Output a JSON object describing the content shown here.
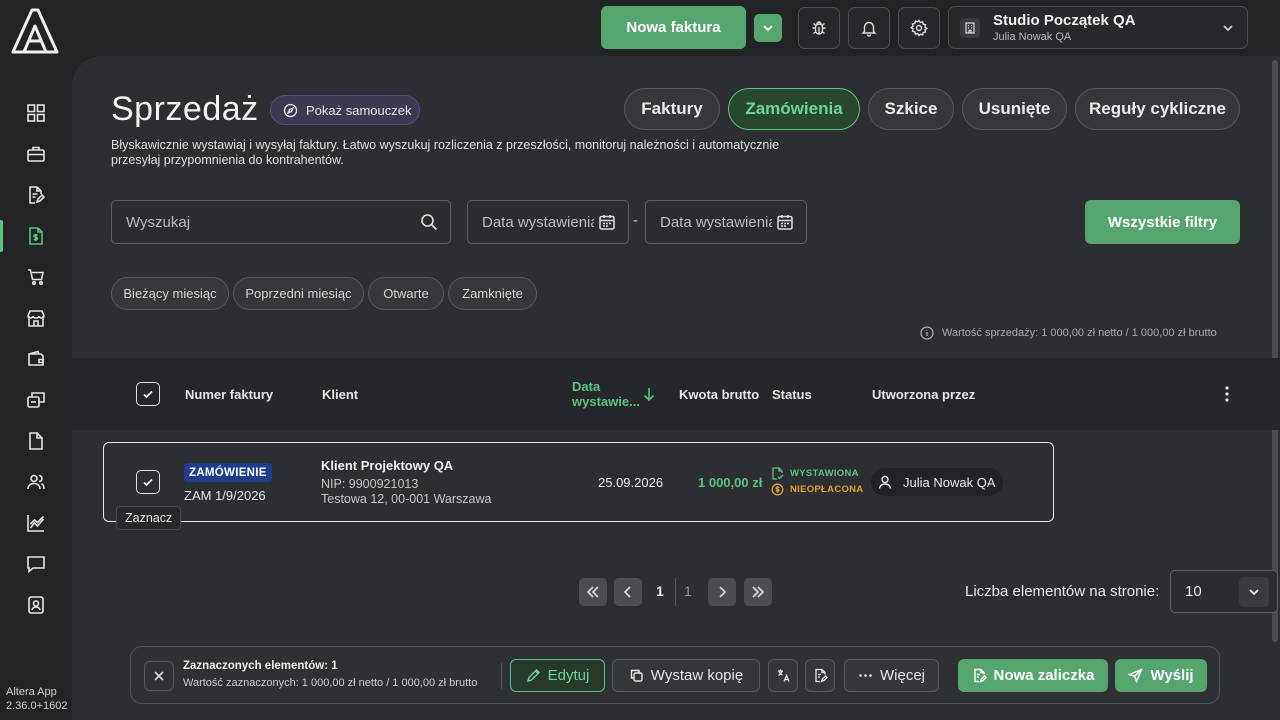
{
  "app": {
    "name": "Altera App",
    "version": "2.36.0+1602"
  },
  "topbar": {
    "new_invoice_label": "Nowa faktura",
    "company": {
      "name": "Studio Początek QA",
      "user": "Julia Nowak QA"
    }
  },
  "sidebar": {
    "items": [
      {
        "name": "dashboard",
        "icon": "grid-icon",
        "active": false
      },
      {
        "name": "briefcase",
        "icon": "briefcase-icon",
        "active": false
      },
      {
        "name": "documents",
        "icon": "document-edit-icon",
        "active": false
      },
      {
        "name": "sales",
        "icon": "dollar-document-icon",
        "active": true
      },
      {
        "name": "purchases",
        "icon": "cart-icon",
        "active": false
      },
      {
        "name": "store",
        "icon": "store-icon",
        "active": false
      },
      {
        "name": "wallet",
        "icon": "wallet-icon",
        "active": false
      },
      {
        "name": "transfers",
        "icon": "transfer-icon",
        "active": false
      },
      {
        "name": "files",
        "icon": "file-icon",
        "active": false
      },
      {
        "name": "contacts",
        "icon": "users-icon",
        "active": false
      },
      {
        "name": "reports",
        "icon": "chart-icon",
        "active": false
      },
      {
        "name": "messages",
        "icon": "chat-icon",
        "active": false
      },
      {
        "name": "profile",
        "icon": "user-badge-icon",
        "active": false
      }
    ]
  },
  "page": {
    "title": "Sprzedaż",
    "tutorial_label": "Pokaż samouczek",
    "description": "Błyskawicznie wystawiaj i wysyłaj faktury. Łatwo wyszukuj rozliczenia z przeszłości, monitoruj należności i automatycznie przesyłaj przypomnienia do kontrahentów.",
    "tabs": [
      {
        "label": "Faktury",
        "active": false
      },
      {
        "label": "Zamówienia",
        "active": true
      },
      {
        "label": "Szkice",
        "active": false
      },
      {
        "label": "Usunięte",
        "active": false
      },
      {
        "label": "Reguły cykliczne",
        "active": false
      }
    ]
  },
  "filters": {
    "search_placeholder": "Wyszukaj",
    "date_from_placeholder": "Data wystawienia",
    "date_to_placeholder": "Data wystawienia",
    "date_separator": "-",
    "all_filters_label": "Wszystkie filtry",
    "chips": [
      "Bieżący miesiąc",
      "Poprzedni miesiąc",
      "Otwarte",
      "Zamknięte"
    ]
  },
  "summary": "Wartość sprzedaży: 1 000,00 zł netto / 1 000,00 zł brutto",
  "table": {
    "columns": {
      "number": "Numer faktury",
      "client": "Klient",
      "date": "Data wystawie...",
      "amount": "Kwota brutto",
      "status": "Status",
      "created_by": "Utworzona przez"
    },
    "rows": [
      {
        "type_badge": "ZAMÓWIENIE",
        "number": "ZAM 1/9/2026",
        "client_name": "Klient Projektowy QA",
        "client_nip": "NIP: 9900921013",
        "client_address": "Testowa 12, 00-001 Warszawa",
        "date": "25.09.2026",
        "amount": "1 000,00 zł",
        "status_issued": "WYSTAWIONA",
        "status_payment": "NIEOPŁACONA",
        "created_by": "Julia Nowak QA",
        "selected": true
      }
    ],
    "checkbox_tooltip": "Zaznacz"
  },
  "pagination": {
    "current_page": "1",
    "total_pages": "1",
    "per_page_label": "Liczba elementów na stronie:",
    "per_page_value": "10"
  },
  "action_bar": {
    "selected_count": "Zaznaczonych elementów: 1",
    "selected_value": "Wartość zaznaczonych: 1 000,00 zł netto / 1 000,00 zł brutto",
    "edit_label": "Edytuj",
    "copy_label": "Wystaw kopię",
    "more_label": "Więcej",
    "advance_label": "Nowa zaliczka",
    "send_label": "Wyślij"
  },
  "colors": {
    "accent": "#5ac383",
    "button_green": "#56a56e",
    "badge_blue": "#1f3c8c",
    "warning": "#e2a033",
    "background": "#212325",
    "panel": "#2c2e31"
  }
}
